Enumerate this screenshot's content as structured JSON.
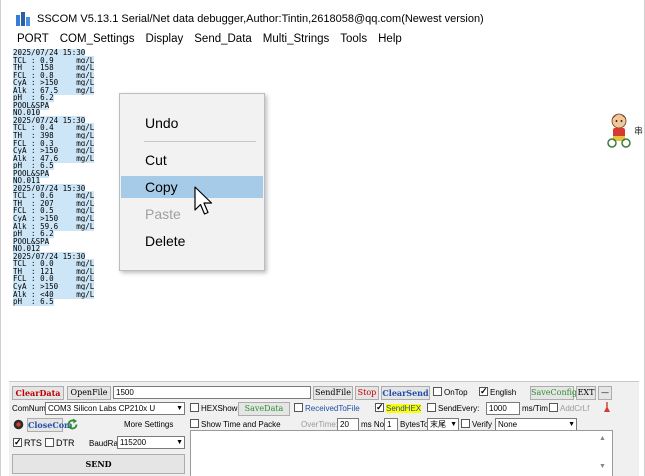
{
  "window": {
    "title": "SSCOM V5.13.1 Serial/Net data debugger,Author:Tintin,2618058@qq.com(Newest version)"
  },
  "menu": [
    "PORT",
    "COM_Settings",
    "Display",
    "Send_Data",
    "Multi_Strings",
    "Tools",
    "Help"
  ],
  "log_lines": [
    "2025/07/24 15:30",
    "TCL : 0.9     mg/L",
    "TH  : 158     mg/L",
    "FCL : 0.8     mg/L",
    "CyA : >150    mg/L",
    "Alk : 67.5    mg/L",
    "pH  : 6.2",
    "POOL&SPA",
    "NO.010",
    "2025/07/24 15:30",
    "TCL : 0.4     mg/L",
    "TH  : 398     mg/L",
    "FCL : 0.3     mg/L",
    "CyA : >150    mg/L",
    "Alk : 47.6    mg/L",
    "pH  : 6.5",
    "POOL&SPA",
    "NO.011",
    "2025/07/24 15:30",
    "TCL : 0.6     mg/L",
    "TH  : 207     mg/L",
    "FCL : 0.5     mg/L",
    "CyA : >150    mg/L",
    "Alk : 59.6    mg/L",
    "pH  : 6.2",
    "POOL&SPA",
    "NO.012",
    "2025/07/24 15:30",
    "TCL : 0.0     mg/L",
    "TH  : 121     mg/L",
    "FCL : 0.0     mg/L",
    "CyA : >150    mg/L",
    "Alk : <40     mg/L",
    "pH  : 6.5"
  ],
  "edge_glyph": "串",
  "context_menu": {
    "undo": "Undo",
    "cut": "Cut",
    "copy": "Copy",
    "paste": "Paste",
    "delete": "Delete"
  },
  "controls": {
    "clear_data": "ClearData",
    "open_file": "OpenFile",
    "file_path": "1500",
    "send_file": "SendFile",
    "stop": "Stop",
    "clear_send": "ClearSend",
    "on_top": "OnTop",
    "english": "English",
    "save_config": "SaveConfig",
    "ext": "EXT",
    "minus": "—",
    "com_num_label": "ComNum",
    "com_port_value": "COM3 Silicon Labs CP210x U",
    "hex_show": "HEXShow",
    "save_data": "SaveData",
    "received_to_file": "ReceivedToFile",
    "send_hex": "SendHEX",
    "send_every": "SendEvery:",
    "send_every_value": "1000",
    "ms_tim": "ms/Tim",
    "add_crlf": "AddCrLf",
    "close_com": "CloseCom",
    "more_settings": "More Settings",
    "show_time": "Show Time and Packe",
    "over_time": "OverTime:",
    "over_time_value": "20",
    "ms_no": "ms No",
    "bytes_value": "1",
    "bytes_to": "BytesTo",
    "tail_value": "末尾",
    "verify_label": "Verify",
    "verify_value": "None",
    "rts": "RTS",
    "dtr": "DTR",
    "baud_label": "BaudRat",
    "baud_value": "115200",
    "send": "SEND"
  },
  "colors": {
    "selection_highlight": "#a6cbe8",
    "log_highlight": "#cde6f7",
    "accent_red": "#c00000",
    "accent_blue": "#1f4fa8"
  }
}
